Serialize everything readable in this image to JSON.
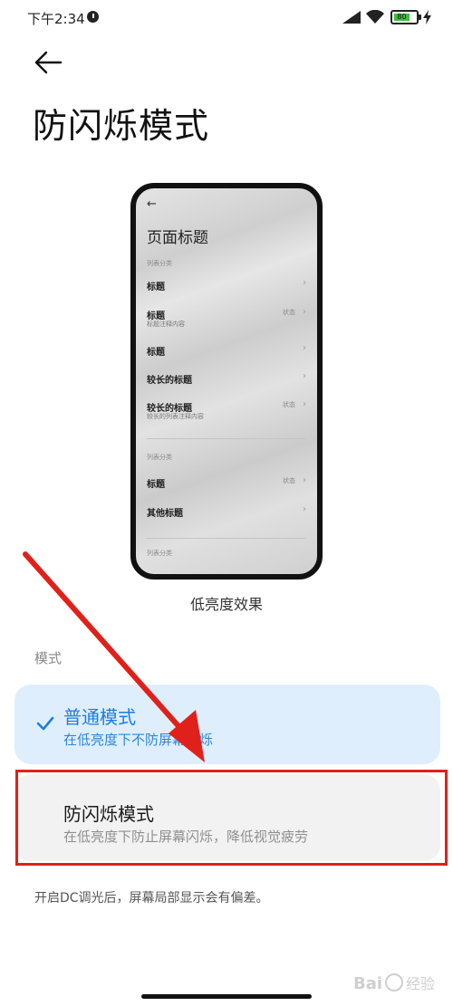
{
  "status_bar": {
    "time": "下午2:34",
    "battery_level": "80",
    "icons": [
      "clock-icon",
      "signal-icon",
      "wifi-icon",
      "battery-icon",
      "charging-bolt-icon"
    ]
  },
  "header": {
    "back_icon": "back-arrow-icon",
    "title": "防闪烁模式"
  },
  "preview": {
    "caption": "低亮度效果",
    "page_title": "页面标题",
    "back_icon": "back-arrow-icon",
    "sections": [
      {
        "category": "列表分类",
        "rows": [
          {
            "title": "标题",
            "subtitle": "",
            "status": ""
          },
          {
            "title": "标题",
            "subtitle": "标题注释内容",
            "status": "状态"
          },
          {
            "title": "标题",
            "subtitle": "",
            "status": ""
          },
          {
            "title": "较长的标题",
            "subtitle": "",
            "status": ""
          },
          {
            "title": "较长的标题",
            "subtitle": "较长的列表注释内容",
            "status": "状态"
          }
        ]
      },
      {
        "category": "列表分类",
        "rows": [
          {
            "title": "标题",
            "subtitle": "",
            "status": "状态"
          },
          {
            "title": "其他标题",
            "subtitle": "",
            "status": ""
          }
        ]
      },
      {
        "category": "列表分类",
        "rows": []
      }
    ]
  },
  "mode_section": {
    "label": "模式",
    "options": [
      {
        "name": "普通模式",
        "description": "在低亮度下不防屏幕闪烁",
        "selected": true
      },
      {
        "name": "防闪烁模式",
        "description": "在低亮度下防止屏幕闪烁，降低视觉疲劳",
        "selected": false
      }
    ]
  },
  "footnote": "开启DC调光后，屏幕局部显示会有偏差。",
  "watermark": {
    "text": "Bai经验"
  },
  "colors": {
    "accent": "#1a7fe0",
    "selected_card_bg": "#dfeefc",
    "card_bg": "#f2f2f2",
    "annotation_red": "#e0201a"
  }
}
